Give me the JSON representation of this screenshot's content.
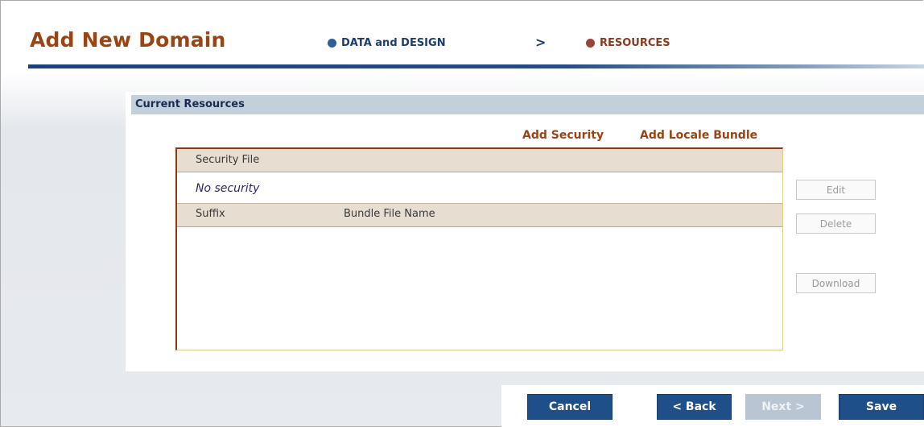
{
  "header": {
    "title": "Add New Domain",
    "steps": [
      {
        "label": "DATA and DESIGN",
        "color": "#2e5f98"
      },
      {
        "label": "RESOURCES",
        "color": "#9a4338"
      }
    ],
    "separator": ">"
  },
  "panel": {
    "title": "Current Resources",
    "links": {
      "add_security": "Add Security",
      "add_locale_bundle": "Add Locale Bundle"
    },
    "security_table": {
      "header": "Security File",
      "empty_text": "No security"
    },
    "bundle_table": {
      "columns": [
        "Suffix",
        "Bundle File Name"
      ],
      "rows": []
    },
    "side_buttons": {
      "edit": "Edit",
      "delete": "Delete",
      "download": "Download"
    }
  },
  "footer": {
    "cancel": "Cancel",
    "back": "< Back",
    "next": "Next >",
    "save": "Save"
  },
  "colors": {
    "brand_title": "#9b4413",
    "primary_button": "#1e4f88",
    "disabled_button": "#b9c5d3"
  }
}
